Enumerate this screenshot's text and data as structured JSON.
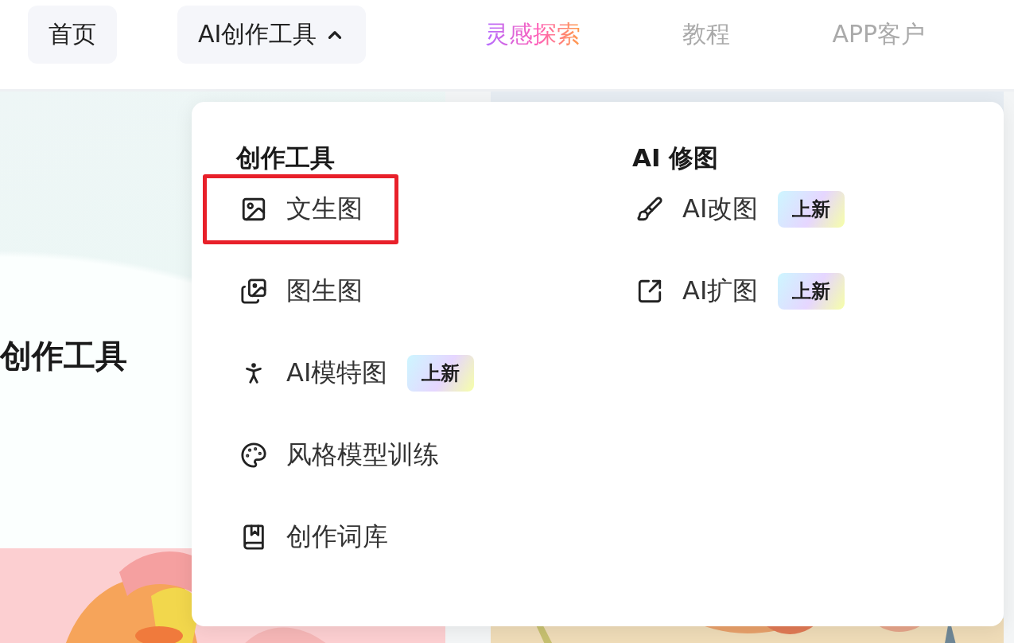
{
  "nav": {
    "items": [
      {
        "label": "首页",
        "kind": "pill"
      },
      {
        "label": "AI创作工具",
        "kind": "dropdown",
        "expanded": true
      },
      {
        "label": "灵感探索",
        "kind": "gradient"
      },
      {
        "label": "教程",
        "kind": "muted"
      },
      {
        "label": "APP客户",
        "kind": "muted"
      }
    ]
  },
  "hero": {
    "title": "创作工具"
  },
  "menu": {
    "columns": [
      {
        "heading": "创作工具",
        "items": [
          {
            "label": "文生图",
            "highlighted": true
          },
          {
            "label": "图生图",
            "highlighted": false
          },
          {
            "label": "AI模特图",
            "highlighted": false,
            "badge": "上新"
          },
          {
            "label": "风格模型训练",
            "highlighted": false
          },
          {
            "label": "创作词库",
            "highlighted": false
          }
        ]
      },
      {
        "heading": "AI 修图",
        "items": [
          {
            "label": "AI改图",
            "highlighted": false,
            "badge": "上新"
          },
          {
            "label": "AI扩图",
            "highlighted": false,
            "badge": "上新"
          }
        ]
      }
    ]
  }
}
